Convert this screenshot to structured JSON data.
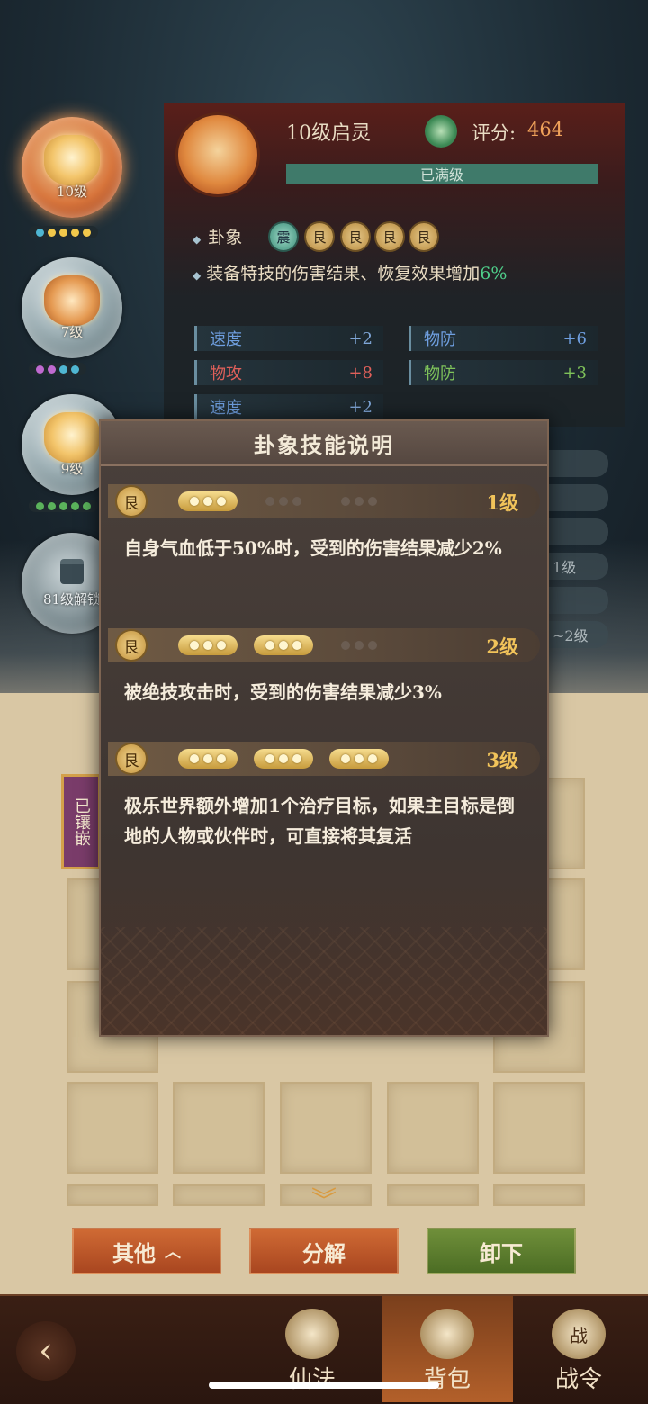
{
  "left_orbs": [
    {
      "level": "10级",
      "dots": [
        "#4fb6d2",
        "#f2c84b",
        "#f2c84b",
        "#f2c84b",
        "#f2c84b"
      ]
    },
    {
      "level": "7级",
      "dots": [
        "#c06ad0",
        "#c06ad0",
        "#4fb6d2",
        "#4fb6d2"
      ]
    },
    {
      "level": "9级",
      "dots": [
        "#5bb35b",
        "#5bb35b",
        "#5bb35b",
        "#5bb35b",
        "#5bb35b"
      ]
    },
    {
      "locked_text": "81级解锁"
    }
  ],
  "gem": {
    "title": "10级启灵",
    "score_label": "评分:",
    "score_value": "464",
    "status": "已满级"
  },
  "trigram": {
    "label": "卦象",
    "chips": [
      "震",
      "艮",
      "艮",
      "艮",
      "艮"
    ]
  },
  "effect": {
    "text": "装备特技的伤害结果、恢复效果增加",
    "percent": "6%"
  },
  "stats": [
    {
      "name": "速度",
      "value": "+2"
    },
    {
      "name": "物防",
      "value": "+6"
    },
    {
      "name": "物攻",
      "value": "+8"
    },
    {
      "name": "物防",
      "value": "+3"
    },
    {
      "name": "速度",
      "value": "+2"
    }
  ],
  "background_rows": [
    "1级",
    "~2级"
  ],
  "inventory": {
    "inlaid_label": "已镶嵌"
  },
  "actions": {
    "other": "其他",
    "decompose": "分解",
    "unequip": "卸下"
  },
  "nav": {
    "back_icon": "back-arrow-icon",
    "tabs": [
      {
        "label": "仙法",
        "icon": "flame-scroll-icon"
      },
      {
        "label": "背包",
        "icon": "bag-icon"
      },
      {
        "label": "战令",
        "icon": "war-token-icon",
        "glyph": "战"
      }
    ]
  },
  "modal": {
    "title": "卦象技能说明",
    "levels": [
      {
        "icon_char": "艮",
        "active_groups": 1,
        "level_label": "1级",
        "description": "自身气血低于50%时，受到的伤害结果减少2%"
      },
      {
        "icon_char": "艮",
        "active_groups": 2,
        "level_label": "2级",
        "description": "被绝技攻击时，受到的伤害结果减少3%"
      },
      {
        "icon_char": "艮",
        "active_groups": 3,
        "level_label": "3级",
        "description": "极乐世界额外增加1个治疗目标，如果主目标是倒地的人物或伙伴时，可直接将其复活"
      }
    ]
  }
}
